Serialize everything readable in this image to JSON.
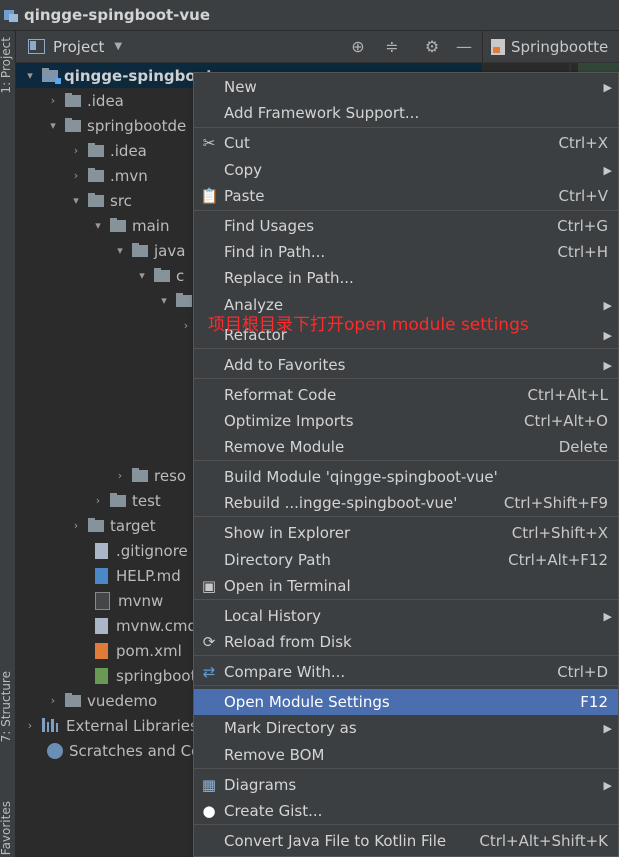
{
  "window": {
    "title": "qingge-spingboot-vue"
  },
  "left_strip": {
    "project_tab": "1: Project",
    "structure_tab": "7: Structure",
    "favorites_tab": "Favorites"
  },
  "project_panel": {
    "title": "Project"
  },
  "editor_tab": {
    "label": "Springbootte"
  },
  "tree": [
    {
      "label": "qingge-spingboot",
      "arrow": "▾",
      "icon": "module",
      "bold": true
    },
    {
      "label": ".idea",
      "arrow": "›",
      "icon": "folder"
    },
    {
      "label": "springbootde",
      "arrow": "▾",
      "icon": "folder"
    },
    {
      "label": ".idea",
      "arrow": "›",
      "icon": "folder"
    },
    {
      "label": ".mvn",
      "arrow": "›",
      "icon": "folder"
    },
    {
      "label": "src",
      "arrow": "▾",
      "icon": "folder"
    },
    {
      "label": "main",
      "arrow": "▾",
      "icon": "folder"
    },
    {
      "label": "java",
      "arrow": "▾",
      "icon": "folder"
    },
    {
      "label": "c",
      "arrow": "▾",
      "icon": "folder"
    },
    {
      "label": "",
      "arrow": "▾",
      "icon": "folder"
    },
    {
      "label": "",
      "arrow": "›",
      "icon": "none"
    },
    {
      "label": "reso",
      "arrow": "›",
      "icon": "folder"
    },
    {
      "label": "test",
      "arrow": "›",
      "icon": "folder"
    },
    {
      "label": "target",
      "arrow": "›",
      "icon": "folder"
    },
    {
      "label": ".gitignore",
      "arrow": "",
      "icon": "file"
    },
    {
      "label": "HELP.md",
      "arrow": "",
      "icon": "md"
    },
    {
      "label": "mvnw",
      "arrow": "",
      "icon": "term"
    },
    {
      "label": "mvnw.cmd",
      "arrow": "",
      "icon": "file"
    },
    {
      "label": "pom.xml",
      "arrow": "",
      "icon": "xml"
    },
    {
      "label": "springboot",
      "arrow": "",
      "icon": "spring"
    },
    {
      "label": "vuedemo",
      "arrow": "›",
      "icon": "folder"
    },
    {
      "label": "External Libraries",
      "arrow": "›",
      "icon": "libs"
    },
    {
      "label": "Scratches and Co",
      "arrow": "",
      "icon": "scratch"
    }
  ],
  "context_menu": {
    "items": [
      {
        "label": "New",
        "shortcut": "",
        "submenu": true,
        "icon": ""
      },
      {
        "label": "Add Framework Support...",
        "shortcut": "",
        "submenu": false,
        "icon": ""
      },
      {
        "label": "Cut",
        "shortcut": "Ctrl+X",
        "submenu": false,
        "icon": "✂"
      },
      {
        "label": "Copy",
        "shortcut": "",
        "submenu": true,
        "icon": ""
      },
      {
        "label": "Paste",
        "shortcut": "Ctrl+V",
        "submenu": false,
        "icon": "📋"
      },
      {
        "label": "Find Usages",
        "shortcut": "Ctrl+G",
        "submenu": false,
        "icon": ""
      },
      {
        "label": "Find in Path...",
        "shortcut": "Ctrl+H",
        "submenu": false,
        "icon": ""
      },
      {
        "label": "Replace in Path...",
        "shortcut": "",
        "submenu": false,
        "icon": ""
      },
      {
        "label": "Analyze",
        "shortcut": "",
        "submenu": true,
        "icon": ""
      },
      {
        "label": "Refactor",
        "shortcut": "",
        "submenu": true,
        "icon": ""
      },
      {
        "label": "Add to Favorites",
        "shortcut": "",
        "submenu": true,
        "icon": ""
      },
      {
        "label": "Reformat Code",
        "shortcut": "Ctrl+Alt+L",
        "submenu": false,
        "icon": ""
      },
      {
        "label": "Optimize Imports",
        "shortcut": "Ctrl+Alt+O",
        "submenu": false,
        "icon": ""
      },
      {
        "label": "Remove Module",
        "shortcut": "Delete",
        "submenu": false,
        "icon": ""
      },
      {
        "label": "Build Module 'qingge-spingboot-vue'",
        "shortcut": "",
        "submenu": false,
        "icon": ""
      },
      {
        "label": "Rebuild ...ingge-spingboot-vue'",
        "shortcut": "Ctrl+Shift+F9",
        "submenu": false,
        "icon": ""
      },
      {
        "label": "Show in Explorer",
        "shortcut": "Ctrl+Shift+X",
        "submenu": false,
        "icon": ""
      },
      {
        "label": "Directory Path",
        "shortcut": "Ctrl+Alt+F12",
        "submenu": false,
        "icon": ""
      },
      {
        "label": "Open in Terminal",
        "shortcut": "",
        "submenu": false,
        "icon": "▣"
      },
      {
        "label": "Local History",
        "shortcut": "",
        "submenu": true,
        "icon": ""
      },
      {
        "label": "Reload from Disk",
        "shortcut": "",
        "submenu": false,
        "icon": "⟳"
      },
      {
        "label": "Compare With...",
        "shortcut": "Ctrl+D",
        "submenu": false,
        "icon": "⇄"
      },
      {
        "label": "Open Module Settings",
        "shortcut": "F12",
        "submenu": false,
        "icon": "",
        "highlighted": true
      },
      {
        "label": "Mark Directory as",
        "shortcut": "",
        "submenu": true,
        "icon": ""
      },
      {
        "label": "Remove BOM",
        "shortcut": "",
        "submenu": false,
        "icon": ""
      },
      {
        "label": "Diagrams",
        "shortcut": "",
        "submenu": true,
        "icon": "▦"
      },
      {
        "label": "Create Gist...",
        "shortcut": "",
        "submenu": false,
        "icon": "●"
      },
      {
        "label": "Convert Java File to Kotlin File",
        "shortcut": "Ctrl+Alt+Shift+K",
        "submenu": false,
        "icon": ""
      }
    ]
  },
  "annotation": {
    "text": "项目根目录下打开open module settings",
    "color": "#ff2a2a"
  },
  "colors": {
    "background": "#2b2b2b",
    "panel": "#3c3f41",
    "highlight": "#4b6eaf"
  }
}
